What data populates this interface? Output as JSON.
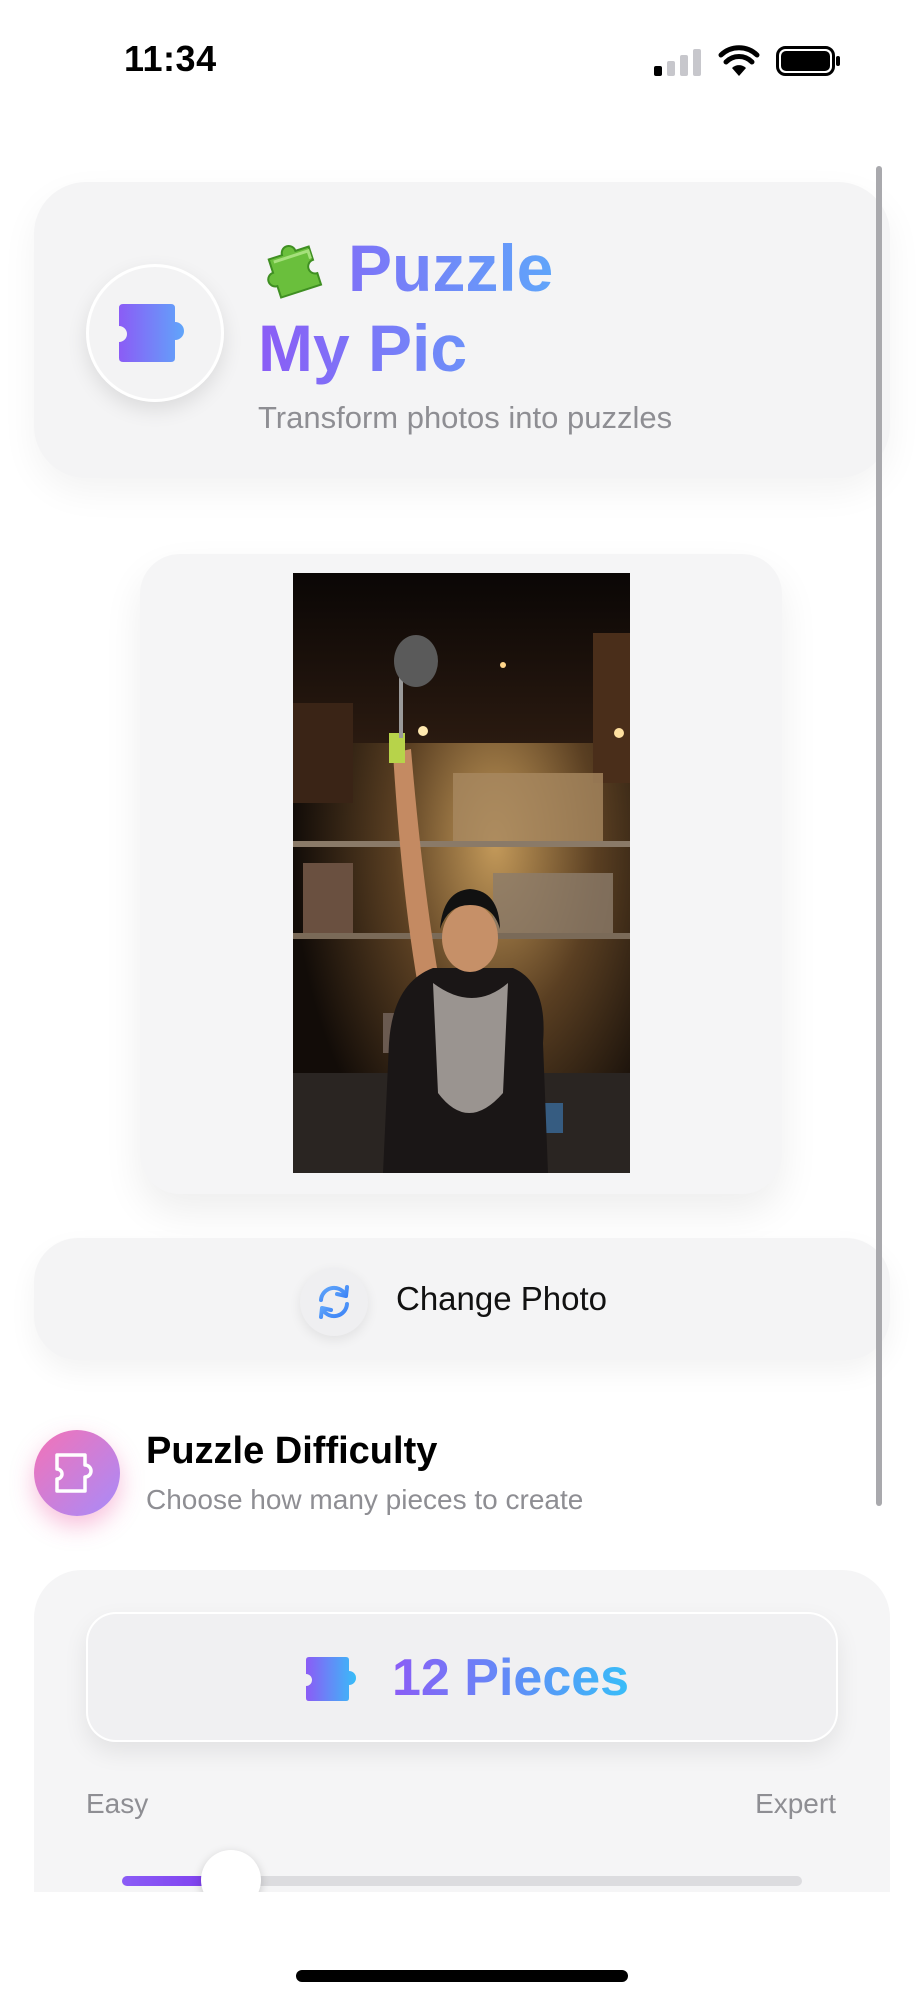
{
  "status_bar": {
    "time": "11:34",
    "signal_bars_active": 1,
    "signal_bars_total": 4,
    "battery_level": 1.0
  },
  "header": {
    "emoji_icon": "puzzle-piece-emoji",
    "title_line1": "Puzzle",
    "title_line2": "My Pic",
    "subtitle": "Transform photos into puzzles",
    "logo_icon": "puzzle-piece-icon"
  },
  "photo": {
    "description_icon": "photo-preview"
  },
  "change_photo": {
    "icon": "refresh-icon",
    "label": "Change Photo"
  },
  "difficulty": {
    "icon": "puzzle-outline-icon",
    "title": "Puzzle Difficulty",
    "subtitle": "Choose how many pieces to create",
    "selected_label": "12 Pieces",
    "min_label": "Easy",
    "max_label": "Expert",
    "slider_value": 0.16
  },
  "colors": {
    "gradient_start": "#8b5cf6",
    "gradient_end": "#60a5fa",
    "accent_pink": "#f472b6",
    "muted_text": "#8e8e93"
  }
}
